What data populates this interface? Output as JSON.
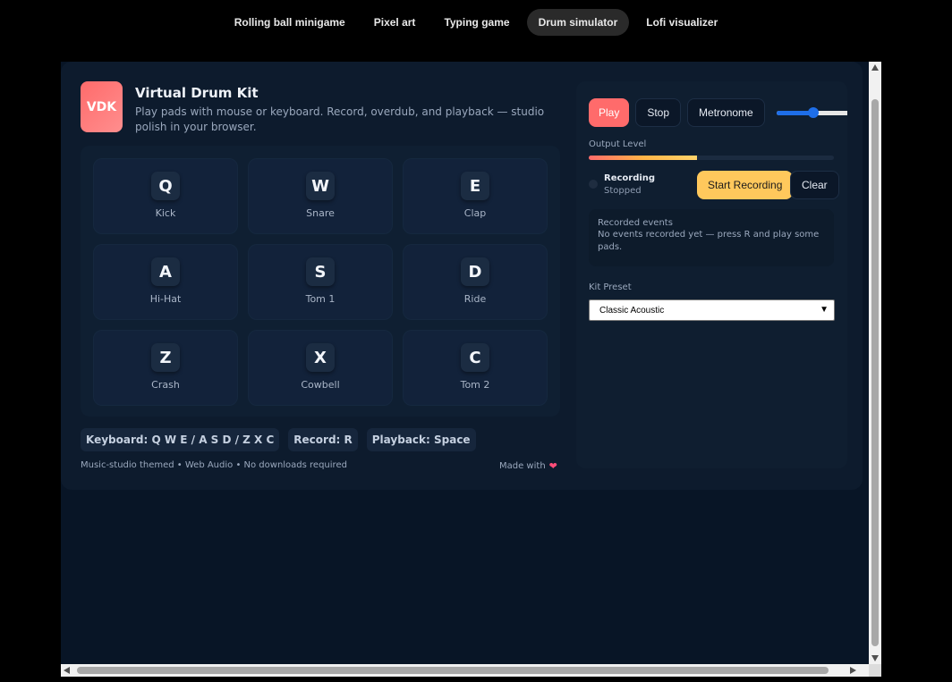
{
  "nav": {
    "tabs": [
      {
        "label": "Rolling ball minigame"
      },
      {
        "label": "Pixel art"
      },
      {
        "label": "Typing game"
      },
      {
        "label": "Drum simulator"
      },
      {
        "label": "Lofi visualizer"
      }
    ],
    "active": "Drum simulator"
  },
  "app": {
    "logo_text": "VDK",
    "title": "Virtual Drum Kit",
    "subtitle": "Play pads with mouse or keyboard. Record, overdub, and playback — studio polish in your browser.",
    "pads": [
      {
        "key": "Q",
        "label": "Kick"
      },
      {
        "key": "W",
        "label": "Snare"
      },
      {
        "key": "E",
        "label": "Clap"
      },
      {
        "key": "A",
        "label": "Hi-Hat"
      },
      {
        "key": "S",
        "label": "Tom 1"
      },
      {
        "key": "D",
        "label": "Ride"
      },
      {
        "key": "Z",
        "label": "Crash"
      },
      {
        "key": "X",
        "label": "Cowbell"
      },
      {
        "key": "C",
        "label": "Tom 2"
      }
    ],
    "chips": {
      "keyboard": "Keyboard: Q W E / A S D / Z X C",
      "record": "Record: R",
      "playback": "Playback: Space"
    },
    "footer": {
      "left": "Music-studio themed • Web Audio • No downloads required",
      "right": "Made with"
    }
  },
  "side": {
    "play_label": "Play",
    "stop_label": "Stop",
    "metronome_label": "Metronome",
    "volume_level": 0.4,
    "output_label": "Output Level",
    "output_level": 0.44,
    "recording_title": "Recording",
    "recording_state": "Stopped",
    "start_recording_label": "Start Recording",
    "clear_label": "Clear",
    "events_title": "Recorded events",
    "events_text": "No events recorded yet — press R and play some pads.",
    "preset_label": "Kit Preset",
    "preset_value": "Classic Acoustic"
  },
  "colors": {
    "accent": "#ff6b6b",
    "record_button": "#ffc85c",
    "heart": "#ff4d79"
  },
  "icons": {
    "heart": "heart-icon",
    "caret": "chevron-down-icon"
  }
}
